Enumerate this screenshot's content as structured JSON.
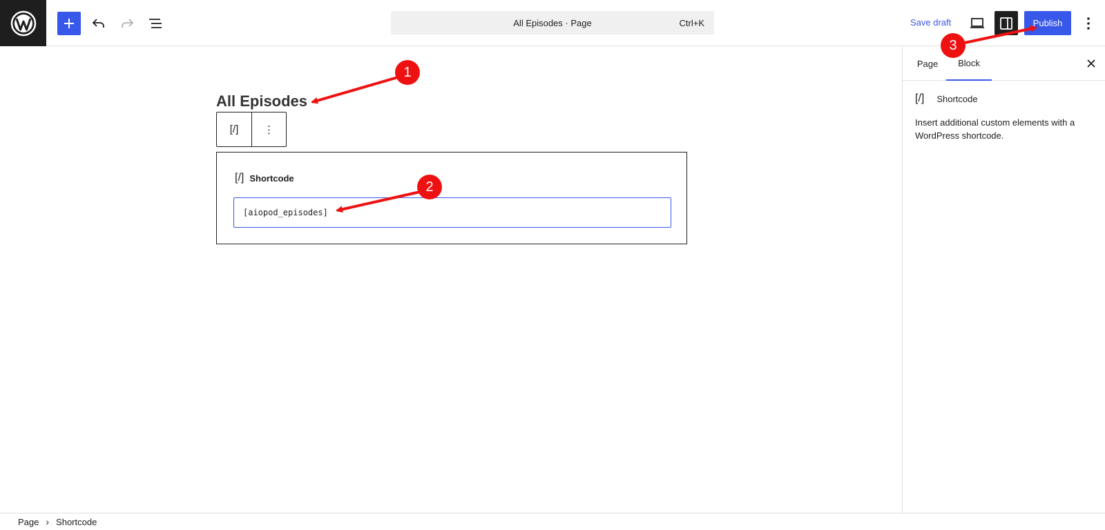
{
  "topbar": {
    "document_title": "All Episodes · Page",
    "shortcut": "Ctrl+K",
    "save_draft_label": "Save draft",
    "publish_label": "Publish",
    "accent_color": "#3858e9"
  },
  "icons": {
    "logo": "wordpress-logo-icon",
    "add": "plus-icon",
    "undo": "undo-icon",
    "redo": "redo-icon",
    "list_view": "list-view-icon",
    "view": "desktop-view-icon",
    "settings": "sidebar-toggle-icon",
    "options": "more-vertical-icon",
    "close": "close-icon",
    "shortcode": "shortcode-icon"
  },
  "canvas": {
    "page_title": "All Episodes",
    "block_toolbar": {
      "block_icon_glyph": "[/]",
      "more_glyph": "⋮"
    },
    "shortcode_block": {
      "icon_glyph": "[/]",
      "label": "Shortcode",
      "value": "[aiopod_episodes]"
    }
  },
  "sidebar": {
    "tabs": [
      {
        "label": "Page",
        "active": false
      },
      {
        "label": "Block",
        "active": true
      }
    ],
    "block_icon_glyph": "[/]",
    "block_name": "Shortcode",
    "block_description": "Insert additional custom elements with a WordPress shortcode."
  },
  "breadcrumb": {
    "items": [
      "Page",
      "Shortcode"
    ],
    "separator": "›"
  },
  "annotations": {
    "color": "#ee1111",
    "markers": [
      "1",
      "2",
      "3"
    ]
  }
}
